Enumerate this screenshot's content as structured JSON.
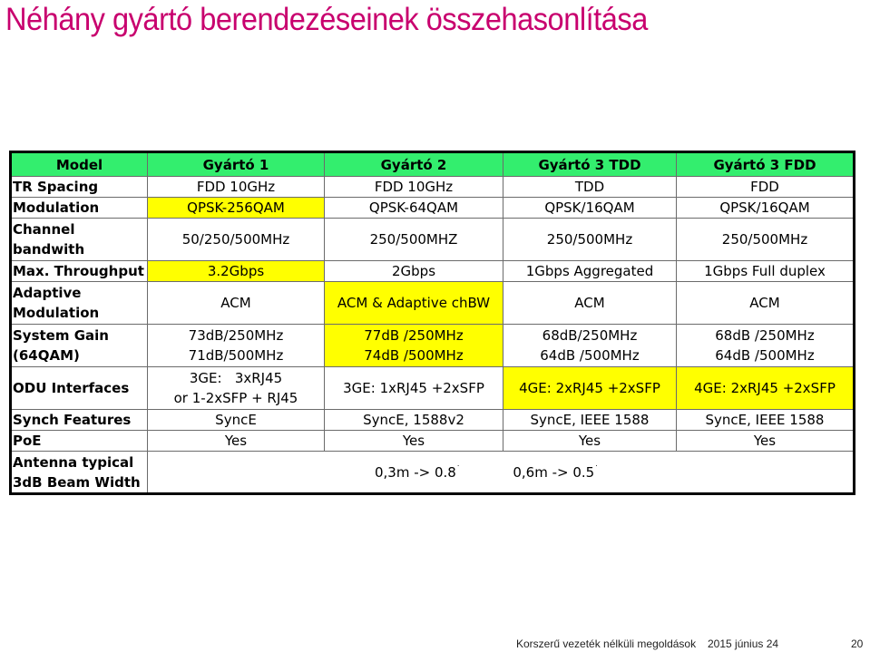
{
  "slide": {
    "title": "Néhány gyártó berendezéseinek összehasonlítása",
    "colors": {
      "title": "#c8006e",
      "header_bg": "#33ee6e",
      "highlight": "#ffff00"
    }
  },
  "table": {
    "headers": [
      "Model",
      "Gyártó 1",
      "Gyártó 2",
      "Gyártó 3 TDD",
      "Gyártó 3 FDD"
    ],
    "rows": {
      "tr_spacing": {
        "label": "TR Spacing",
        "cells": [
          "FDD 10GHz",
          "FDD 10GHz",
          "TDD",
          "FDD"
        ]
      },
      "modulation": {
        "label": "Modulation",
        "cells": [
          "QPSK-256QAM",
          "QPSK-64QAM",
          "QPSK/16QAM",
          "QPSK/16QAM"
        ],
        "highlight": [
          true,
          false,
          false,
          false
        ]
      },
      "channel_bw": {
        "label_line1": "Channel",
        "label_line2": "bandwith",
        "cells": [
          "50/250/500MHz",
          "250/500MHZ",
          "250/500MHz",
          "250/500MHz"
        ]
      },
      "max_throughput": {
        "label": "Max. Throughput",
        "cells": [
          "3.2Gbps",
          "2Gbps",
          "1Gbps Aggregated",
          "1Gbps Full duplex"
        ],
        "highlight": [
          true,
          false,
          false,
          false
        ]
      },
      "adaptive_mod": {
        "label_line1": "Adaptive",
        "label_line2": "Modulation",
        "cells": [
          "ACM",
          "ACM & Adaptive chBW",
          "ACM",
          "ACM"
        ],
        "highlight": [
          false,
          true,
          false,
          false
        ]
      },
      "system_gain": {
        "label_line1": "System Gain",
        "label_line2": "(64QAM)",
        "cells": [
          {
            "line1": "73dB/250MHz",
            "line2": "71dB/500MHz"
          },
          {
            "line1": "77dB /250MHz",
            "line2": "74dB /500MHz"
          },
          {
            "line1": "68dB/250MHz",
            "line2": "64dB /500MHz"
          },
          {
            "line1": "68dB /250MHz",
            "line2": "64dB /500MHz"
          }
        ],
        "highlight": [
          false,
          true,
          false,
          false
        ]
      },
      "odu_interfaces": {
        "label": "ODU Interfaces",
        "cells": [
          {
            "line1": "3GE:   3xRJ45",
            "line2": "or 1-2xSFP + RJ45"
          },
          "3GE: 1xRJ45 +2xSFP",
          "4GE: 2xRJ45 +2xSFP",
          "4GE: 2xRJ45 +2xSFP"
        ],
        "highlight": [
          false,
          false,
          true,
          true
        ]
      },
      "synch": {
        "label": "Synch Features",
        "cells": [
          "SyncE",
          "SyncE, 1588v2",
          "SyncE, IEEE 1588",
          "SyncE, IEEE 1588"
        ]
      },
      "poe": {
        "label": "PoE",
        "cells": [
          "Yes",
          "Yes",
          "Yes",
          "Yes"
        ]
      },
      "antenna": {
        "label_line1": "Antenna typical",
        "label_line2": "3dB Beam Width",
        "value1": "0,3m -> 0.8",
        "value1_sup": "˙",
        "value2": "0,6m -> 0.5",
        "value2_sup": "˙"
      }
    }
  },
  "footer": {
    "course": "Korszerű vezeték nélküli megoldások",
    "date": "2015 június 24",
    "page": "20"
  }
}
